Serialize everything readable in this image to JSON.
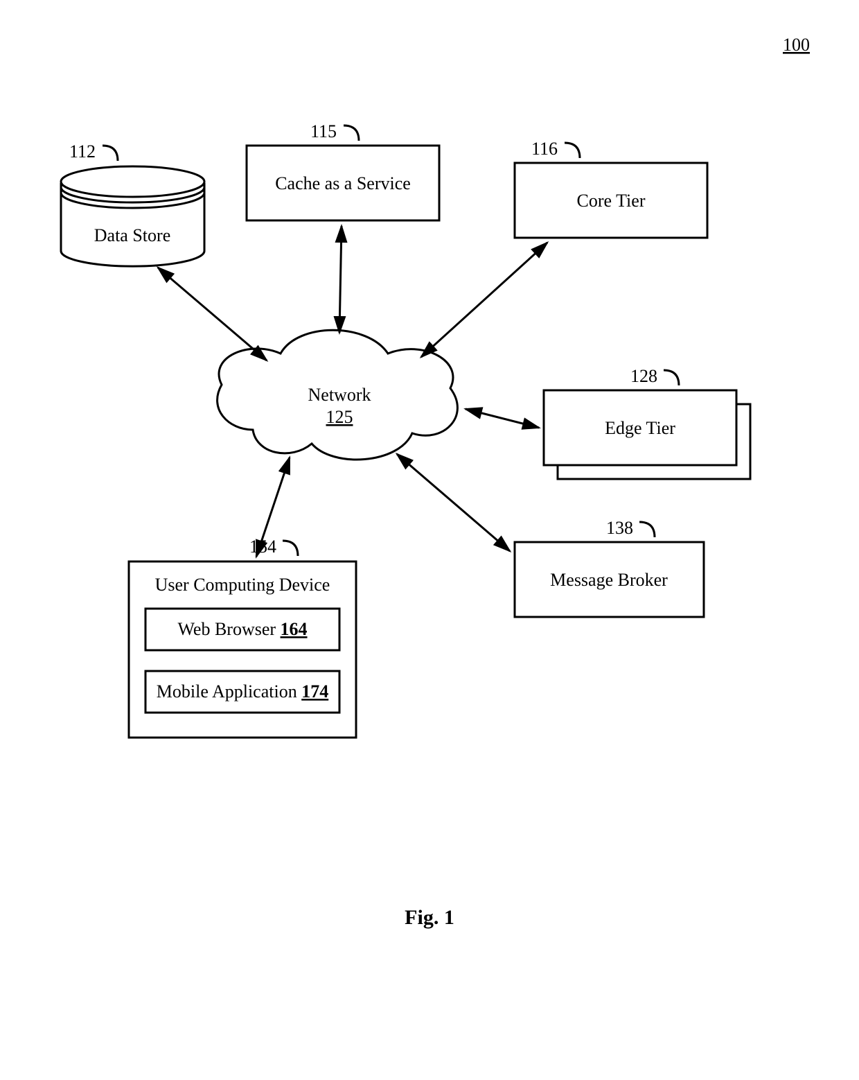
{
  "figure_number": "100",
  "labels": {
    "data_store": {
      "num": "112",
      "text": "Data Store"
    },
    "cache": {
      "num": "115",
      "text": "Cache as a Service"
    },
    "core": {
      "num": "116",
      "text": "Core Tier"
    },
    "edge": {
      "num": "128",
      "text": "Edge Tier"
    },
    "broker": {
      "num": "138",
      "text": "Message Broker"
    },
    "user_device": {
      "num": "154",
      "text": "User Computing Device"
    },
    "web_browser": {
      "prefix": "Web Browser ",
      "num": "164"
    },
    "mobile_app": {
      "prefix": "Mobile Application ",
      "num": "174"
    },
    "network": {
      "text": "Network",
      "num": "125"
    }
  },
  "caption": "Fig. 1"
}
